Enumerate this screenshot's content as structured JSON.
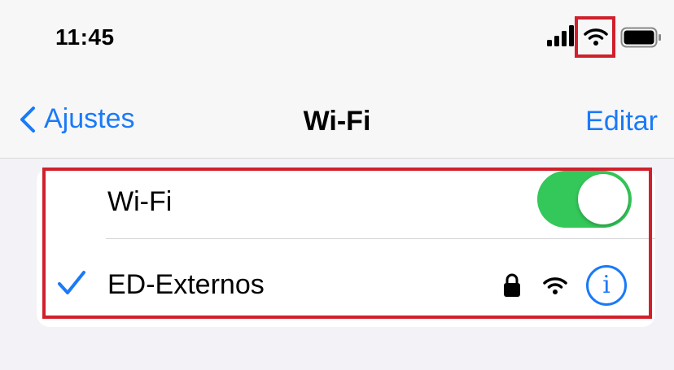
{
  "status_bar": {
    "time": "11:45"
  },
  "nav": {
    "back_label": "Ajustes",
    "title": "Wi-Fi",
    "edit_label": "Editar"
  },
  "wifi_row": {
    "label": "Wi-Fi",
    "enabled": true
  },
  "network_row": {
    "name": "ED-Externos",
    "connected": true,
    "secured": true,
    "info_icon": "i"
  },
  "colors": {
    "accent": "#1a7af8",
    "toggle_on": "#34c759",
    "highlight": "#d0202b"
  },
  "icons": [
    "cellular-signal-icon",
    "wifi-icon",
    "battery-icon",
    "chevron-left-icon",
    "checkmark-icon",
    "lock-icon",
    "info-icon"
  ]
}
